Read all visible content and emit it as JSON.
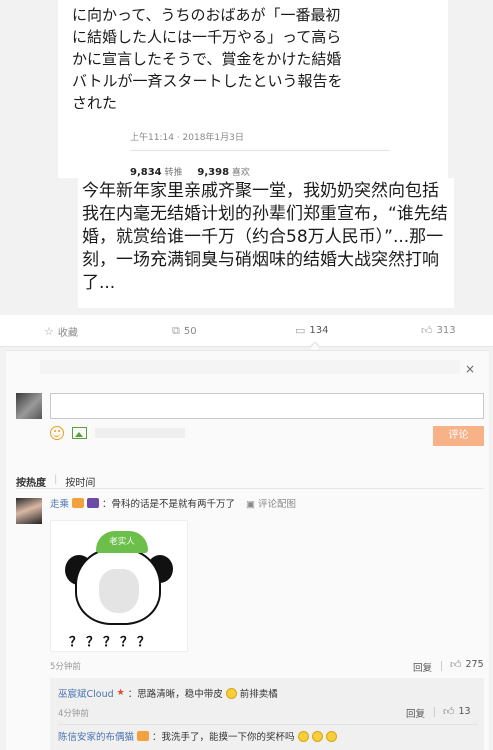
{
  "tweet": {
    "text": "に向かって、うちのおばあが「一番最初\nに結婚した人には一千万やる」って高ら\nかに宣言したそうで、賞金をかけた結婚\nバトルが一斉スタートしたという報告を\nされた",
    "time": "上午11:14 · 2018年1月3日",
    "retweets_count": "9,834",
    "retweets_label": "转推",
    "likes_count": "9,398",
    "likes_label": "喜欢"
  },
  "caption": "今年新年家里亲戚齐聚一堂，我奶奶突然向包括我在内毫无结婚计划的孙辈们郑重宣布，“谁先结婚，就赏给谁一千万（约合58万人民币）”...那一刻，一场充满铜臭与硝烟味的结婚大战突然打响了...",
  "actions": {
    "favorite_label": "收藏",
    "repost_count": "50",
    "comment_count": "134",
    "like_count": "313"
  },
  "comment_box": {
    "close_icon": "×",
    "submit_label": "评论",
    "input_placeholder": ""
  },
  "sort": {
    "by_heat": "按热度",
    "by_time": "按时间"
  },
  "comments": [
    {
      "user": "走乘",
      "text": "：骨科的话是不是就有两千万了",
      "picture_link": "评论配图",
      "meme_hat_text": "老实人",
      "meme_caption": "？？？？？",
      "time": "5分钟前",
      "reply_label": "回复",
      "likes": "275"
    }
  ],
  "replies": [
    {
      "user": "巫宸斌Cloud",
      "text": "：思路清晰，稳中带皮",
      "text2": "前排卖橘",
      "time": "4分钟前",
      "reply_label": "回复",
      "likes": "13"
    },
    {
      "user": "陈信安家的布偶猫",
      "text": "：我洗手了，能摸一下你的奖杯吗"
    }
  ],
  "colors": {
    "username": "#4a72b0",
    "submit_bg": "#f7b288",
    "meme_hat": "#6bbf4a"
  }
}
